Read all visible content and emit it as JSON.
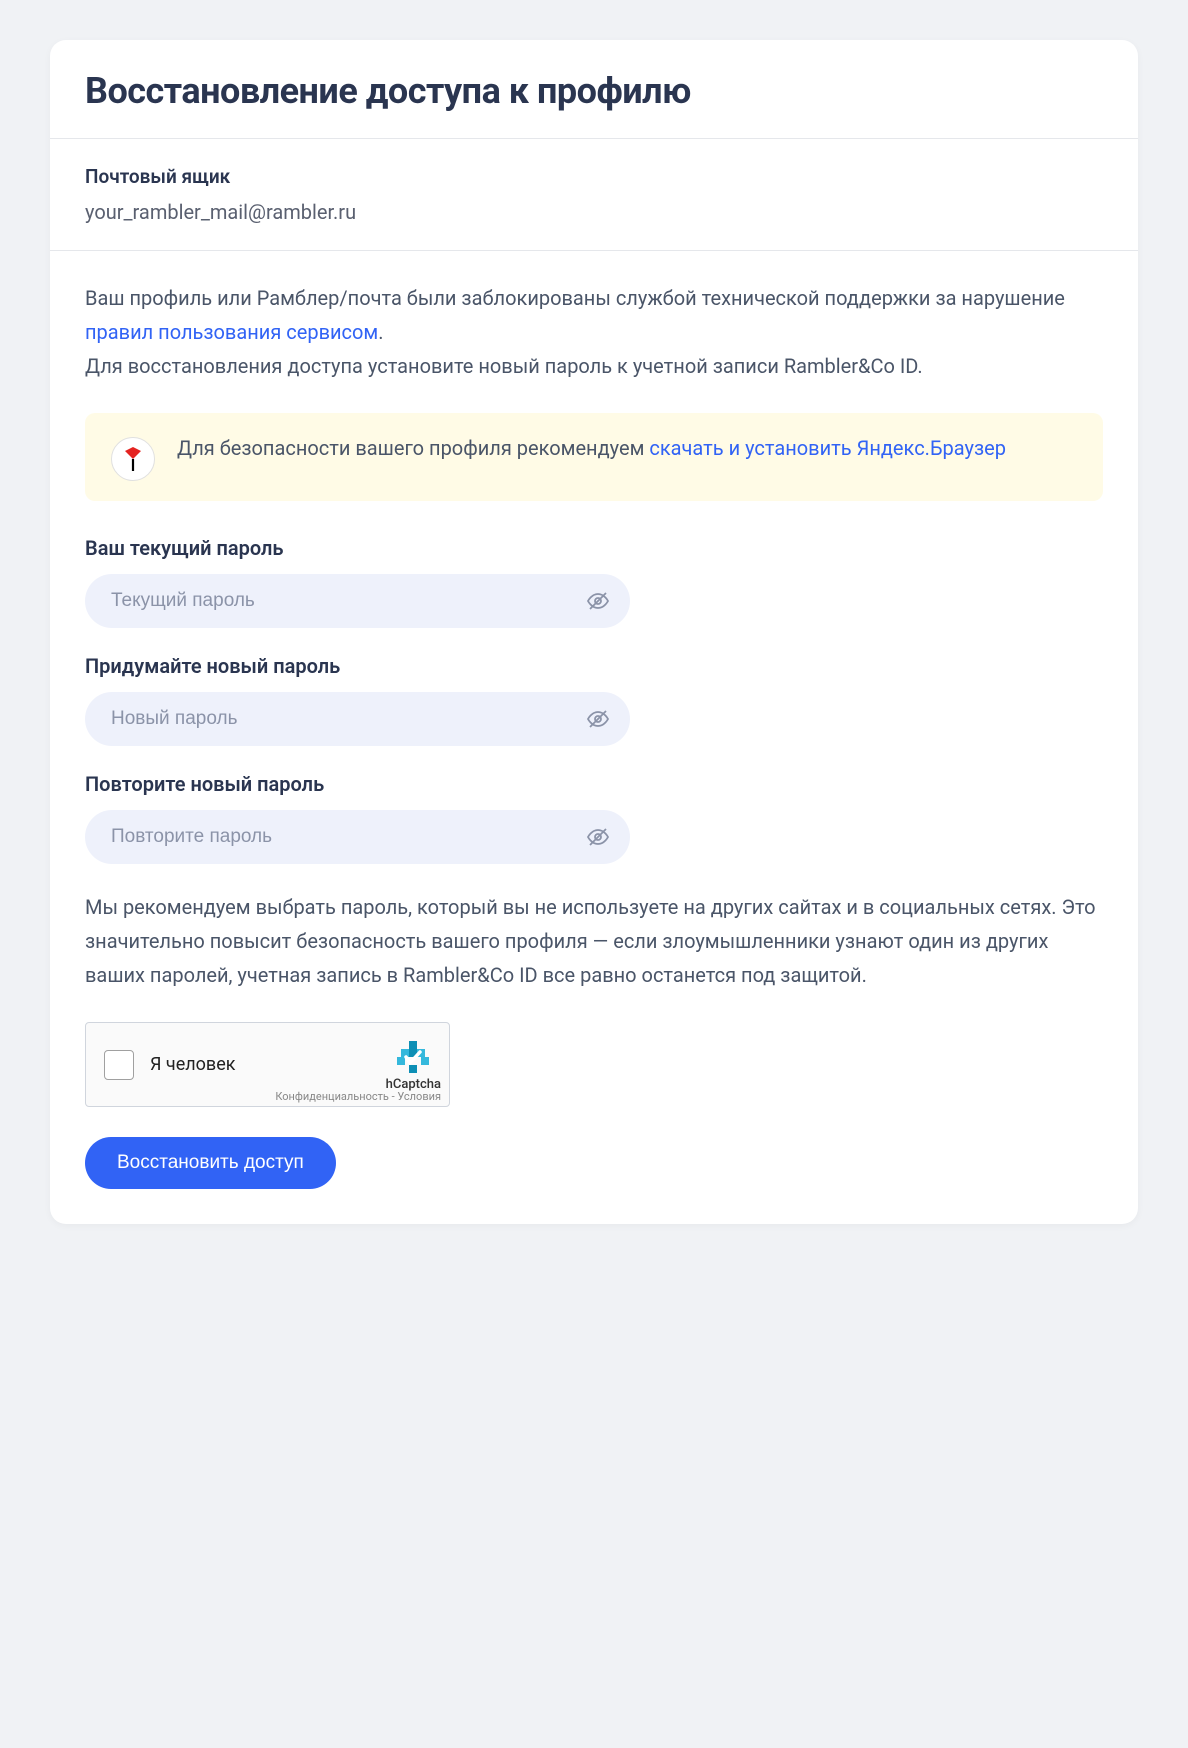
{
  "header": {
    "title": "Восстановление доступа к профилю"
  },
  "mailbox": {
    "label": "Почтовый ящик",
    "value": "your_rambler_mail@rambler.ru"
  },
  "description": {
    "text1": "Ваш профиль или Рамблер/почта были заблокированы службой технической поддержки за нарушение ",
    "link1": "правил пользования сервисом",
    "text2": ".",
    "text3": "Для восстановления доступа установите новый пароль к учетной записи Rambler&Co ID."
  },
  "notice": {
    "text1": "Для безопасности вашего профиля рекомендуем ",
    "link1": "скачать и установить Яндекс.Браузер"
  },
  "form": {
    "current_password": {
      "label": "Ваш текущий пароль",
      "placeholder": "Текущий пароль"
    },
    "new_password": {
      "label": "Придумайте новый пароль",
      "placeholder": "Новый пароль"
    },
    "confirm_password": {
      "label": "Повторите новый пароль",
      "placeholder": "Повторите пароль"
    }
  },
  "tips": "Мы рекомендуем выбрать пароль, который вы не используете на других сайтах и в социальных сетях. Это значительно повысит безопасность вашего профиля — если злоумышленники узнают один из других ваших паролей, учетная запись в Rambler&Co ID все равно останется под защитой.",
  "captcha": {
    "label": "Я человек",
    "brand": "hCaptcha",
    "privacy_terms": "Конфиденциальность - Условия"
  },
  "submit": {
    "label": "Восстановить доступ"
  }
}
